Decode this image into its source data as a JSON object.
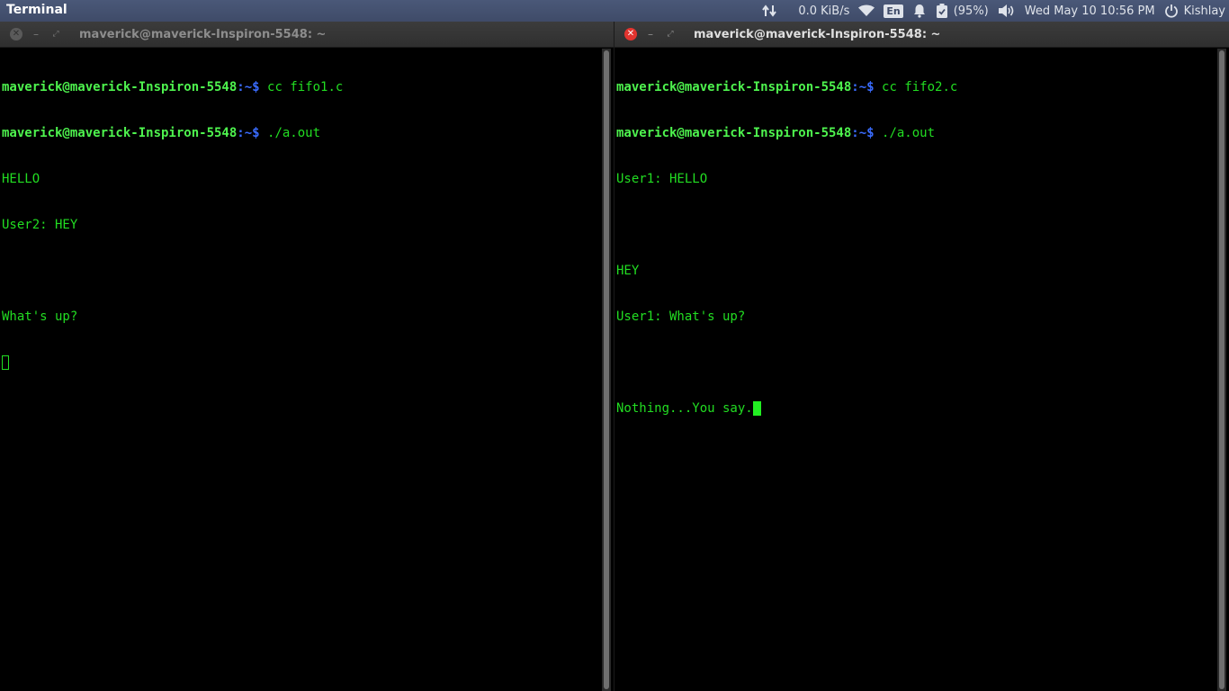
{
  "topbar": {
    "app_title": "Terminal",
    "network_speed": "0.0 KiB/s",
    "language": "En",
    "battery": "(95%)",
    "datetime": "Wed May 10 10:56 PM",
    "user": "Kishlay",
    "icons": [
      "network-transfer-icon",
      "wifi-icon",
      "keyboard-language-icon",
      "notification-bell-icon",
      "battery-icon",
      "volume-icon",
      "session-power-icon"
    ]
  },
  "windows": [
    {
      "title": "maverick@maverick-Inspiron-5548: ~",
      "focused": false,
      "lines": [
        {
          "user": "maverick@maverick-Inspiron-5548",
          "path": ":~$",
          "cmd": " cc fifo1.c"
        },
        {
          "user": "maverick@maverick-Inspiron-5548",
          "path": ":~$",
          "cmd": " ./a.out"
        },
        {
          "text": "HELLO"
        },
        {
          "text": "User2: HEY"
        },
        {
          "text": ""
        },
        {
          "text": "What's up?"
        }
      ]
    },
    {
      "title": "maverick@maverick-Inspiron-5548: ~",
      "focused": true,
      "lines": [
        {
          "user": "maverick@maverick-Inspiron-5548",
          "path": ":~$",
          "cmd": " cc fifo2.c"
        },
        {
          "user": "maverick@maverick-Inspiron-5548",
          "path": ":~$",
          "cmd": " ./a.out"
        },
        {
          "text": "User1: HELLO"
        },
        {
          "text": ""
        },
        {
          "text": "HEY"
        },
        {
          "text": "User1: What's up?"
        },
        {
          "text": ""
        },
        {
          "text": "Nothing...You say."
        }
      ]
    }
  ],
  "colors": {
    "terminal_text": "#22dd22",
    "prompt_user": "#4ef34e",
    "prompt_path": "#3a6cff",
    "close_active": "#e3342f",
    "panel": "#3f4b68"
  }
}
